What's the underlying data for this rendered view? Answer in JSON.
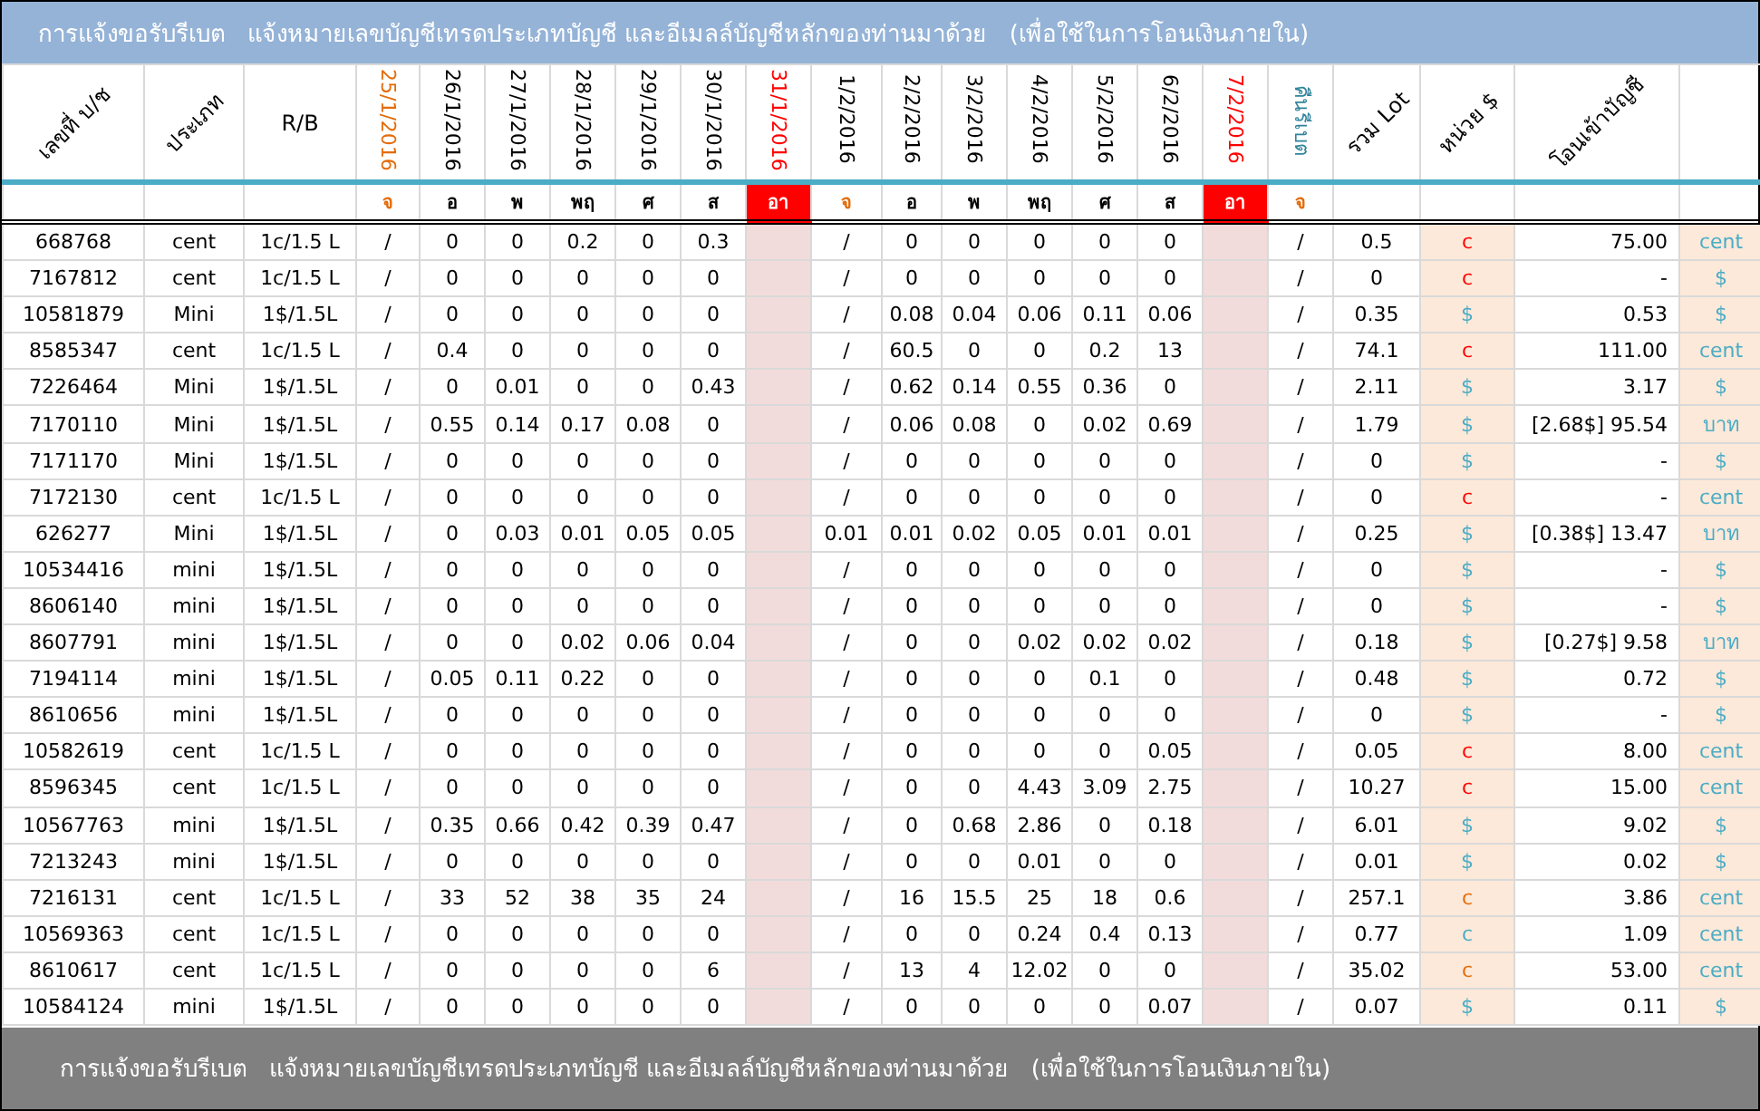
{
  "title": "การแจ้งขอรับรีเบต   แจ้งหมายเลขบัญชีเทรดประเภทบัญชี และอีเมลล์บัญชีหลักของท่านมาด้วย   (เพื่อใช้ในการโอนเงินภายใน)",
  "columns": [
    {
      "kind": "slanted",
      "label": "เลขที่ บ/ช"
    },
    {
      "kind": "slanted",
      "label": "ประเภท"
    },
    {
      "kind": "plain",
      "label": "R/B"
    },
    {
      "kind": "date",
      "label": "25/1/2016",
      "color": "#e46c0a",
      "day": {
        "label": "จ",
        "kind": "text",
        "color": "#e46c0a"
      }
    },
    {
      "kind": "date",
      "label": "26/1/2016",
      "color": "#000000",
      "day": {
        "label": "อ",
        "kind": "text",
        "color": "#000000"
      }
    },
    {
      "kind": "date",
      "label": "27/1/2016",
      "color": "#000000",
      "day": {
        "label": "พ",
        "kind": "text",
        "color": "#000000"
      }
    },
    {
      "kind": "date",
      "label": "28/1/2016",
      "color": "#000000",
      "day": {
        "label": "พฤ",
        "kind": "text",
        "color": "#000000"
      }
    },
    {
      "kind": "date",
      "label": "29/1/2016",
      "color": "#000000",
      "day": {
        "label": "ศ",
        "kind": "text",
        "color": "#000000"
      }
    },
    {
      "kind": "date",
      "label": "30/1/2016",
      "color": "#000000",
      "day": {
        "label": "ส",
        "kind": "text",
        "color": "#000000"
      }
    },
    {
      "kind": "holiday",
      "label": "31/1/2016",
      "color": "#ff0000",
      "day": {
        "label": "อา",
        "kind": "filled",
        "color": "#ff0000"
      }
    },
    {
      "kind": "date",
      "label": "1/2/2016",
      "color": "#000000",
      "day": {
        "label": "จ",
        "kind": "text",
        "color": "#e46c0a"
      }
    },
    {
      "kind": "date",
      "label": "2/2/2016",
      "color": "#000000",
      "day": {
        "label": "อ",
        "kind": "text",
        "color": "#000000"
      }
    },
    {
      "kind": "date",
      "label": "3/2/2016",
      "color": "#000000",
      "day": {
        "label": "พ",
        "kind": "text",
        "color": "#000000"
      }
    },
    {
      "kind": "date",
      "label": "4/2/2016",
      "color": "#000000",
      "day": {
        "label": "พฤ",
        "kind": "text",
        "color": "#000000"
      }
    },
    {
      "kind": "date",
      "label": "5/2/2016",
      "color": "#000000",
      "day": {
        "label": "ศ",
        "kind": "text",
        "color": "#000000"
      }
    },
    {
      "kind": "date",
      "label": "6/2/2016",
      "color": "#000000",
      "day": {
        "label": "ส",
        "kind": "text",
        "color": "#000000"
      }
    },
    {
      "kind": "holiday",
      "label": "7/2/2016",
      "color": "#ff0000",
      "day": {
        "label": "อา",
        "kind": "filled",
        "color": "#ff0000"
      }
    },
    {
      "kind": "rebate",
      "label": "คืนรีเบต",
      "color": "#31849b",
      "day": {
        "label": "จ",
        "kind": "text",
        "color": "#e46c0a"
      }
    },
    {
      "kind": "lot",
      "label": "รวม Lot"
    },
    {
      "kind": "unit",
      "label": "หน่วย $"
    },
    {
      "kind": "amount",
      "label": "โอนเข้าบัญชี"
    },
    {
      "kind": "currency"
    }
  ],
  "rows": [
    {
      "account": "668768",
      "type": "cent",
      "rb": "1c/1.5 L",
      "daily": [
        "/",
        "0",
        "0",
        "0.2",
        "0",
        "0.3",
        "/",
        "0",
        "0",
        "0",
        "0",
        "0"
      ],
      "rebate": "/",
      "lot": "0.5",
      "unit": {
        "text": "c",
        "color": "#ff0000"
      },
      "amount": "75.00",
      "currency": "cent"
    },
    {
      "account": "7167812",
      "type": "cent",
      "rb": "1c/1.5 L",
      "daily": [
        "/",
        "0",
        "0",
        "0",
        "0",
        "0",
        "/",
        "0",
        "0",
        "0",
        "0",
        "0"
      ],
      "rebate": "/",
      "lot": "0",
      "unit": {
        "text": "c",
        "color": "#ff0000"
      },
      "amount": "-",
      "currency": "$"
    },
    {
      "account": "10581879",
      "type": "Mini",
      "rb": "1$/1.5L",
      "daily": [
        "/",
        "0",
        "0",
        "0",
        "0",
        "0",
        "/",
        "0.08",
        "0.04",
        "0.06",
        "0.11",
        "0.06"
      ],
      "rebate": "/",
      "lot": "0.35",
      "unit": {
        "text": "$",
        "color": "#4bacc6"
      },
      "amount": "0.53",
      "currency": "$"
    },
    {
      "account": "8585347",
      "type": "cent",
      "rb": "1c/1.5 L",
      "daily": [
        "/",
        "0.4",
        "0",
        "0",
        "0",
        "0",
        "/",
        "60.5",
        "0",
        "0",
        "0.2",
        "13"
      ],
      "rebate": "/",
      "lot": "74.1",
      "unit": {
        "text": "c",
        "color": "#ff0000"
      },
      "amount": "111.00",
      "currency": "cent"
    },
    {
      "account": "7226464",
      "type": "Mini",
      "rb": "1$/1.5L",
      "daily": [
        "/",
        "0",
        "0.01",
        "0",
        "0",
        "0.43",
        "/",
        "0.62",
        "0.14",
        "0.55",
        "0.36",
        "0"
      ],
      "rebate": "/",
      "lot": "2.11",
      "unit": {
        "text": "$",
        "color": "#4bacc6"
      },
      "amount": "3.17",
      "currency": "$"
    },
    {
      "account": "7170110",
      "type": "Mini",
      "rb": "1$/1.5L",
      "daily": [
        "/",
        "0.55",
        "0.14",
        "0.17",
        "0.08",
        "0",
        "/",
        "0.06",
        "0.08",
        "0",
        "0.02",
        "0.69"
      ],
      "rebate": "/",
      "lot": "1.79",
      "unit": {
        "text": "$",
        "color": "#4bacc6"
      },
      "amount": "[2.68$] 95.54",
      "currency": "บาท"
    },
    {
      "account": "7171170",
      "type": "Mini",
      "rb": "1$/1.5L",
      "daily": [
        "/",
        "0",
        "0",
        "0",
        "0",
        "0",
        "/",
        "0",
        "0",
        "0",
        "0",
        "0"
      ],
      "rebate": "/",
      "lot": "0",
      "unit": {
        "text": "$",
        "color": "#4bacc6"
      },
      "amount": "-",
      "currency": "$"
    },
    {
      "account": "7172130",
      "type": "cent",
      "rb": "1c/1.5 L",
      "daily": [
        "/",
        "0",
        "0",
        "0",
        "0",
        "0",
        "/",
        "0",
        "0",
        "0",
        "0",
        "0"
      ],
      "rebate": "/",
      "lot": "0",
      "unit": {
        "text": "c",
        "color": "#ff0000"
      },
      "amount": "-",
      "currency": "cent"
    },
    {
      "account": "626277",
      "type": "Mini",
      "rb": "1$/1.5L",
      "daily": [
        "/",
        "0",
        "0.03",
        "0.01",
        "0.05",
        "0.05",
        "0.01",
        "0.01",
        "0.02",
        "0.05",
        "0.01",
        "0.01"
      ],
      "rebate": "/",
      "lot": "0.25",
      "unit": {
        "text": "$",
        "color": "#4bacc6"
      },
      "amount": "[0.38$] 13.47",
      "currency": "บาท"
    },
    {
      "account": "10534416",
      "type": "mini",
      "rb": "1$/1.5L",
      "daily": [
        "/",
        "0",
        "0",
        "0",
        "0",
        "0",
        "/",
        "0",
        "0",
        "0",
        "0",
        "0"
      ],
      "rebate": "/",
      "lot": "0",
      "unit": {
        "text": "$",
        "color": "#4bacc6"
      },
      "amount": "-",
      "currency": "$"
    },
    {
      "account": "8606140",
      "type": "mini",
      "rb": "1$/1.5L",
      "daily": [
        "/",
        "0",
        "0",
        "0",
        "0",
        "0",
        "/",
        "0",
        "0",
        "0",
        "0",
        "0"
      ],
      "rebate": "/",
      "lot": "0",
      "unit": {
        "text": "$",
        "color": "#4bacc6"
      },
      "amount": "-",
      "currency": "$"
    },
    {
      "account": "8607791",
      "type": "mini",
      "rb": "1$/1.5L",
      "daily": [
        "/",
        "0",
        "0",
        "0.02",
        "0.06",
        "0.04",
        "/",
        "0",
        "0",
        "0.02",
        "0.02",
        "0.02"
      ],
      "rebate": "/",
      "lot": "0.18",
      "unit": {
        "text": "$",
        "color": "#4bacc6"
      },
      "amount": "[0.27$] 9.58",
      "currency": "บาท"
    },
    {
      "account": "7194114",
      "type": "mini",
      "rb": "1$/1.5L",
      "daily": [
        "/",
        "0.05",
        "0.11",
        "0.22",
        "0",
        "0",
        "/",
        "0",
        "0",
        "0",
        "0.1",
        "0"
      ],
      "rebate": "/",
      "lot": "0.48",
      "unit": {
        "text": "$",
        "color": "#4bacc6"
      },
      "amount": "0.72",
      "currency": "$"
    },
    {
      "account": "8610656",
      "type": "mini",
      "rb": "1$/1.5L",
      "daily": [
        "/",
        "0",
        "0",
        "0",
        "0",
        "0",
        "/",
        "0",
        "0",
        "0",
        "0",
        "0"
      ],
      "rebate": "/",
      "lot": "0",
      "unit": {
        "text": "$",
        "color": "#4bacc6"
      },
      "amount": "-",
      "currency": "$"
    },
    {
      "account": "10582619",
      "type": "cent",
      "rb": "1c/1.5 L",
      "daily": [
        "/",
        "0",
        "0",
        "0",
        "0",
        "0",
        "/",
        "0",
        "0",
        "0",
        "0",
        "0.05"
      ],
      "rebate": "/",
      "lot": "0.05",
      "unit": {
        "text": "c",
        "color": "#ff0000"
      },
      "amount": "8.00",
      "currency": "cent"
    },
    {
      "account": "8596345",
      "type": "cent",
      "rb": "1c/1.5 L",
      "daily": [
        "/",
        "0",
        "0",
        "0",
        "0",
        "0",
        "/",
        "0",
        "0",
        "4.43",
        "3.09",
        "2.75"
      ],
      "rebate": "/",
      "lot": "10.27",
      "unit": {
        "text": "c",
        "color": "#ff0000"
      },
      "amount": "15.00",
      "currency": "cent"
    },
    {
      "account": "10567763",
      "type": "mini",
      "rb": "1$/1.5L",
      "daily": [
        "/",
        "0.35",
        "0.66",
        "0.42",
        "0.39",
        "0.47",
        "/",
        "0",
        "0.68",
        "2.86",
        "0",
        "0.18"
      ],
      "rebate": "/",
      "lot": "6.01",
      "unit": {
        "text": "$",
        "color": "#4bacc6"
      },
      "amount": "9.02",
      "currency": "$"
    },
    {
      "account": "7213243",
      "type": "mini",
      "rb": "1$/1.5L",
      "daily": [
        "/",
        "0",
        "0",
        "0",
        "0",
        "0",
        "/",
        "0",
        "0",
        "0.01",
        "0",
        "0"
      ],
      "rebate": "/",
      "lot": "0.01",
      "unit": {
        "text": "$",
        "color": "#4bacc6"
      },
      "amount": "0.02",
      "currency": "$"
    },
    {
      "account": "7216131",
      "type": "cent",
      "rb": "1c/1.5 L",
      "daily": [
        "/",
        "33",
        "52",
        "38",
        "35",
        "24",
        "/",
        "16",
        "15.5",
        "25",
        "18",
        "0.6"
      ],
      "rebate": "/",
      "lot": "257.1",
      "unit": {
        "text": "c",
        "color": "#e46c0a"
      },
      "amount": "3.86",
      "currency": "cent"
    },
    {
      "account": "10569363",
      "type": "cent",
      "rb": "1c/1.5 L",
      "daily": [
        "/",
        "0",
        "0",
        "0",
        "0",
        "0",
        "/",
        "0",
        "0",
        "0.24",
        "0.4",
        "0.13"
      ],
      "rebate": "/",
      "lot": "0.77",
      "unit": {
        "text": "c",
        "color": "#4bacc6"
      },
      "amount": "1.09",
      "currency": "cent"
    },
    {
      "account": "8610617",
      "type": "cent",
      "rb": "1c/1.5 L",
      "daily": [
        "/",
        "0",
        "0",
        "0",
        "0",
        "6",
        "/",
        "13",
        "4",
        "12.02",
        "0",
        "0"
      ],
      "rebate": "/",
      "lot": "35.02",
      "unit": {
        "text": "c",
        "color": "#e46c0a"
      },
      "amount": "53.00",
      "currency": "cent"
    },
    {
      "account": "10584124",
      "type": "mini",
      "rb": "1$/1.5L",
      "daily": [
        "/",
        "0",
        "0",
        "0",
        "0",
        "0",
        "/",
        "0",
        "0",
        "0",
        "0",
        "0.07"
      ],
      "rebate": "/",
      "lot": "0.07",
      "unit": {
        "text": "$",
        "color": "#4bacc6"
      },
      "amount": "0.11",
      "currency": "$"
    }
  ],
  "footer": "การแจ้งขอรับรีเบต   แจ้งหมายเลขบัญชีเทรดประเภทบัญชี และอีเมลล์บัญชีหลักของท่านมาด้วย   (เพื่อใช้ในการโอนเงินภายใน)"
}
